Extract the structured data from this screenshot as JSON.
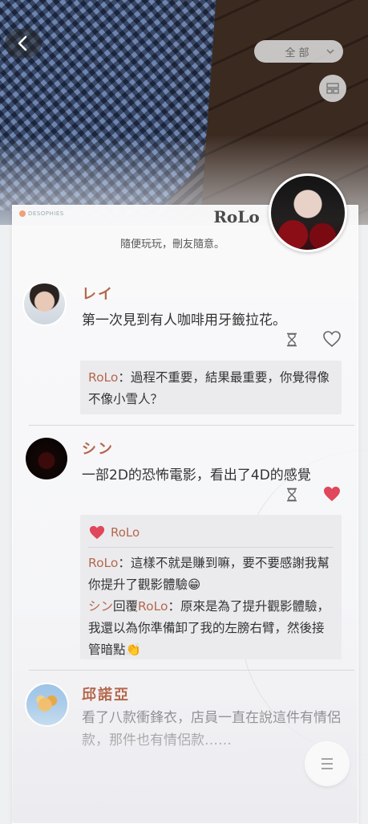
{
  "header": {
    "filter_label": "全部",
    "back_icon": "chevron-left-icon",
    "layout_icon": "layout-grid-icon"
  },
  "profile": {
    "brand": "DESOPHIES",
    "name": "RoLo",
    "bio": "隨便玩玩，刪友隨意。"
  },
  "posts": [
    {
      "user": "レイ",
      "text": "第一次見到有人咖啡用牙籤拉花。",
      "liked": false,
      "replies": [
        {
          "prefix": "",
          "author": "RoLo",
          "text": "：過程不重要，結果最重要，你覺得像不像小雪人？"
        }
      ]
    },
    {
      "user": "シン",
      "text": "一部2D的恐怖電影，看出了4D的感覺",
      "liked": true,
      "like_name": "RoLo",
      "replies": [
        {
          "author": "RoLo",
          "text": "：這樣不就是賺到嘛，要不要感謝我幫你提升了觀影體驗😁"
        },
        {
          "author": "シン",
          "mid": "回覆",
          "author2": "RoLo",
          "text": "：原來是為了提升觀影體驗，我還以為你準備卸了我的左膀右臂，然後接管暗點👏"
        }
      ]
    },
    {
      "user": "邱諾亞",
      "text": "看了八款衝鋒衣，店員一直在說這件有情侶款，那件也有情侶款……"
    }
  ],
  "colors": {
    "name_accent": "#b5684c",
    "heart_liked": "#e0475a",
    "text": "#333333"
  },
  "fab": {
    "icon": "menu-icon"
  }
}
